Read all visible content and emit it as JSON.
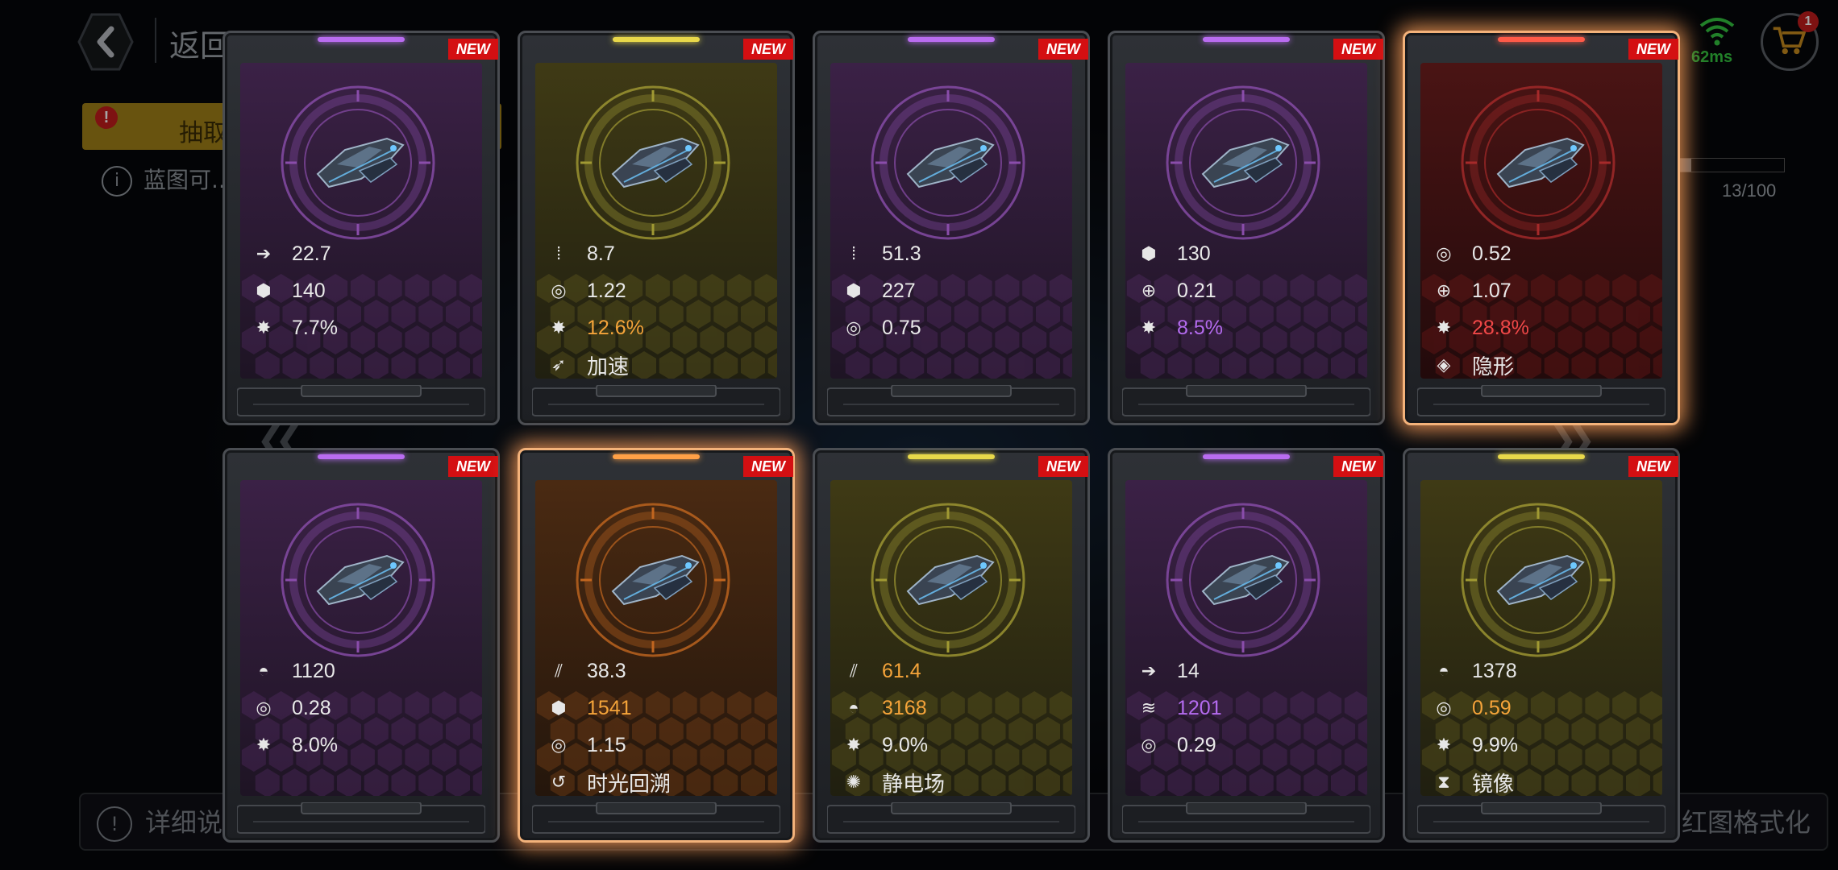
{
  "background": {
    "back_label": "返回",
    "tab_label": "抽取",
    "tab_alert": "!",
    "info_text": "蓝图可...",
    "progress_label": "13/100",
    "progress_fraction": 0.13,
    "ping": "62ms",
    "cart_badge": "1",
    "bottom_left": "详细说",
    "bottom_right": "红图格式化"
  },
  "new_badge": "NEW",
  "colors": {
    "purple": "#b46bef",
    "yellow": "#d9c84a",
    "red": "#e5483c",
    "orange": "#f2a23a",
    "accent_white": "#e9e9e9",
    "accent_orange": "#f5a43a"
  },
  "cards": [
    {
      "rarity": "purple",
      "glow": "",
      "stats": [
        {
          "icon": "arrow-icon",
          "value": "22.7",
          "color": "white"
        },
        {
          "icon": "shield-cells-icon",
          "value": "140",
          "color": "white"
        },
        {
          "icon": "crit-icon",
          "value": "7.7%",
          "color": "white"
        }
      ]
    },
    {
      "rarity": "yellow",
      "glow": "",
      "stats": [
        {
          "icon": "ammo-icon",
          "value": "8.7",
          "color": "white"
        },
        {
          "icon": "gear-icon",
          "value": "1.22",
          "color": "white"
        },
        {
          "icon": "crit-icon",
          "value": "12.6%",
          "color": "orange"
        },
        {
          "icon": "boost-icon",
          "value": "加速",
          "color": "white",
          "skill": true
        }
      ]
    },
    {
      "rarity": "purple",
      "glow": "",
      "stats": [
        {
          "icon": "ammo-icon",
          "value": "51.3",
          "color": "white"
        },
        {
          "icon": "shield-cells-icon",
          "value": "227",
          "color": "white"
        },
        {
          "icon": "gear-icon",
          "value": "0.75",
          "color": "white"
        }
      ]
    },
    {
      "rarity": "purple",
      "glow": "",
      "stats": [
        {
          "icon": "shield-cells-icon",
          "value": "130",
          "color": "white"
        },
        {
          "icon": "crosshair-icon",
          "value": "0.21",
          "color": "white"
        },
        {
          "icon": "crit-icon",
          "value": "8.5%",
          "color": "purple"
        }
      ]
    },
    {
      "rarity": "red",
      "glow": "red",
      "stats": [
        {
          "icon": "gear-icon",
          "value": "0.52",
          "color": "white"
        },
        {
          "icon": "crosshair-icon",
          "value": "1.07",
          "color": "white"
        },
        {
          "icon": "crit-icon",
          "value": "28.8%",
          "color": "red"
        },
        {
          "icon": "cloak-icon",
          "value": "隐形",
          "color": "white",
          "skill": true
        }
      ]
    },
    {
      "rarity": "purple",
      "glow": "",
      "stats": [
        {
          "icon": "armor-icon",
          "value": "1120",
          "color": "white"
        },
        {
          "icon": "gear-icon",
          "value": "0.28",
          "color": "white"
        },
        {
          "icon": "crit-icon",
          "value": "8.0%",
          "color": "white"
        }
      ]
    },
    {
      "rarity": "orange",
      "glow": "orange",
      "stats": [
        {
          "icon": "blades-icon",
          "value": "38.3",
          "color": "white"
        },
        {
          "icon": "shield-cells-icon",
          "value": "1541",
          "color": "orange"
        },
        {
          "icon": "gear-icon",
          "value": "1.15",
          "color": "white"
        },
        {
          "icon": "rewind-icon",
          "value": "时光回溯",
          "color": "white",
          "skill": true
        }
      ]
    },
    {
      "rarity": "yellow",
      "glow": "",
      "stats": [
        {
          "icon": "blades-icon",
          "value": "61.4",
          "color": "orange"
        },
        {
          "icon": "armor-icon",
          "value": "3168",
          "color": "orange"
        },
        {
          "icon": "crit-icon",
          "value": "9.0%",
          "color": "white"
        },
        {
          "icon": "static-field-icon",
          "value": "静电场",
          "color": "white",
          "skill": true
        }
      ]
    },
    {
      "rarity": "purple",
      "glow": "",
      "stats": [
        {
          "icon": "arrow-icon",
          "value": "14",
          "color": "white"
        },
        {
          "icon": "hull-icon",
          "value": "1201",
          "color": "purple"
        },
        {
          "icon": "gear-icon",
          "value": "0.29",
          "color": "white"
        }
      ]
    },
    {
      "rarity": "yellow",
      "glow": "",
      "stats": [
        {
          "icon": "armor-icon",
          "value": "1378",
          "color": "white"
        },
        {
          "icon": "gear-icon",
          "value": "0.59",
          "color": "orange"
        },
        {
          "icon": "crit-icon",
          "value": "9.9%",
          "color": "white"
        },
        {
          "icon": "mirror-icon",
          "value": "镜像",
          "color": "white",
          "skill": true
        }
      ]
    }
  ]
}
